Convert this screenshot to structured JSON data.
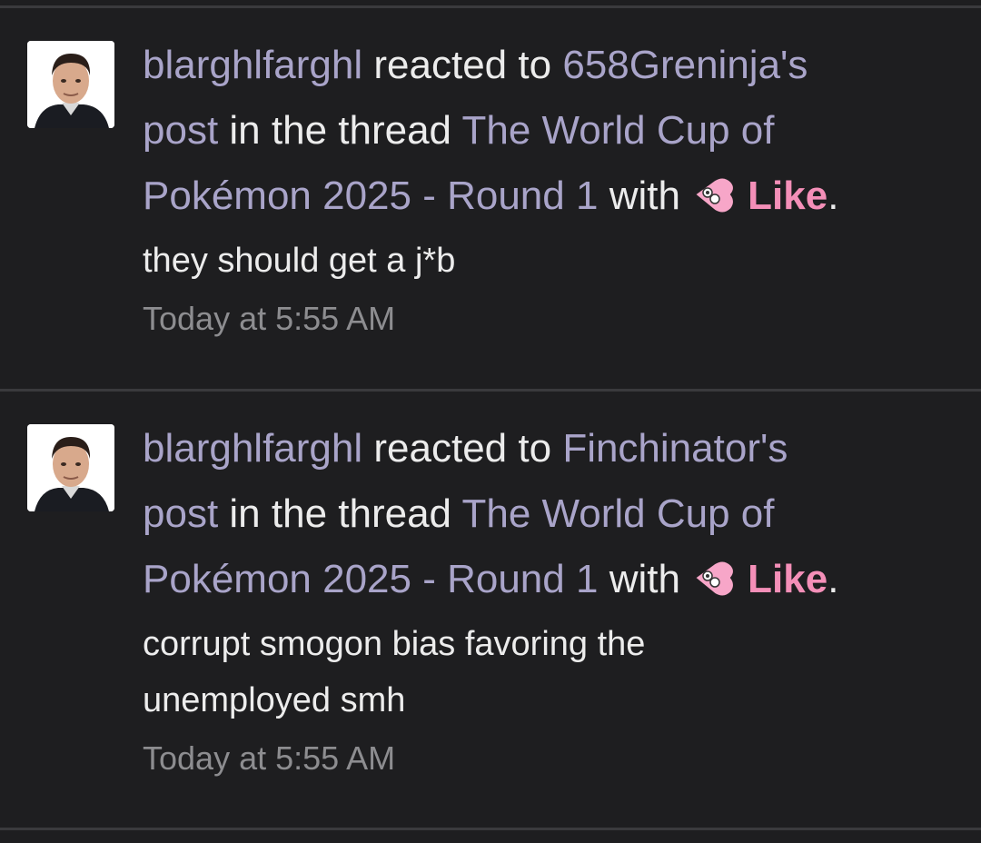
{
  "alerts": [
    {
      "user": "blarghlfarghl",
      "action": "reacted to",
      "target_user": "658Greninja's",
      "post_word": "post",
      "in_thread": "in the thread",
      "thread_title_1": "The World Cup of",
      "thread_title_2": "Pokémon 2025 - Round 1",
      "with": "with",
      "reaction": "Like",
      "period": ".",
      "snippet": "they should get a j*b",
      "time": "Today at 5:55 AM"
    },
    {
      "user": "blarghlfarghl",
      "action": "reacted to",
      "target_user": "Finchinator's",
      "post_word": "post",
      "in_thread": "in the thread",
      "thread_title_1": "The World Cup of",
      "thread_title_2": "Pokémon 2025 - Round 1",
      "with": "with",
      "reaction": "Like",
      "period": ".",
      "snippet_line_1": "corrupt smogon bias favoring the",
      "snippet_line_2": "unemployed smh",
      "time": "Today at 5:55 AM"
    }
  ],
  "colors": {
    "background": "#1e1e20",
    "link": "#a9a4c9",
    "reaction": "#f48fb8",
    "timestamp": "#8d8d90"
  },
  "icons": {
    "reaction_icon": "pink-heart-face-icon",
    "avatar": "user-avatar-photo"
  }
}
